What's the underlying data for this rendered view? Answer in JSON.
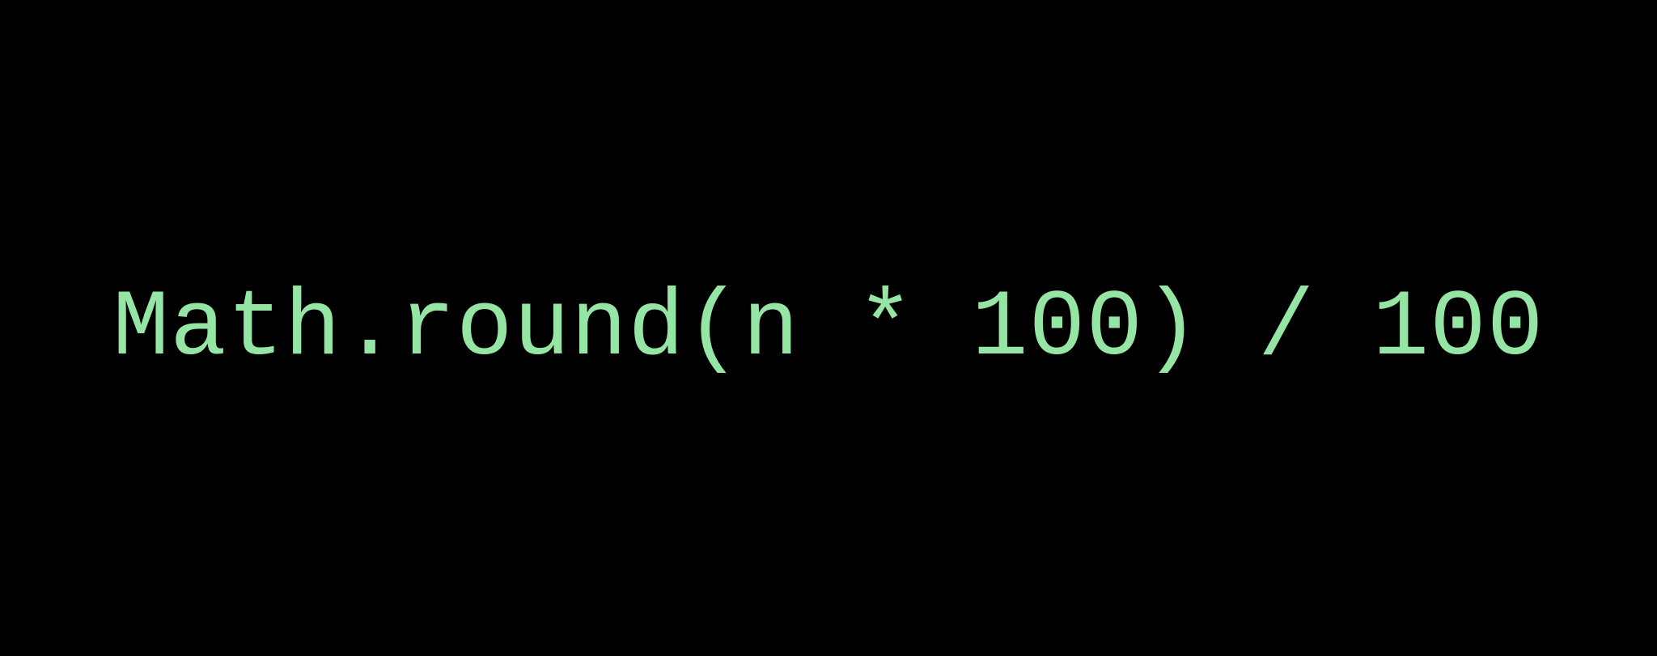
{
  "code": {
    "expression": "Math.round(n * 100) / 100",
    "text_color": "#95e6a4",
    "background_color": "#000000"
  }
}
